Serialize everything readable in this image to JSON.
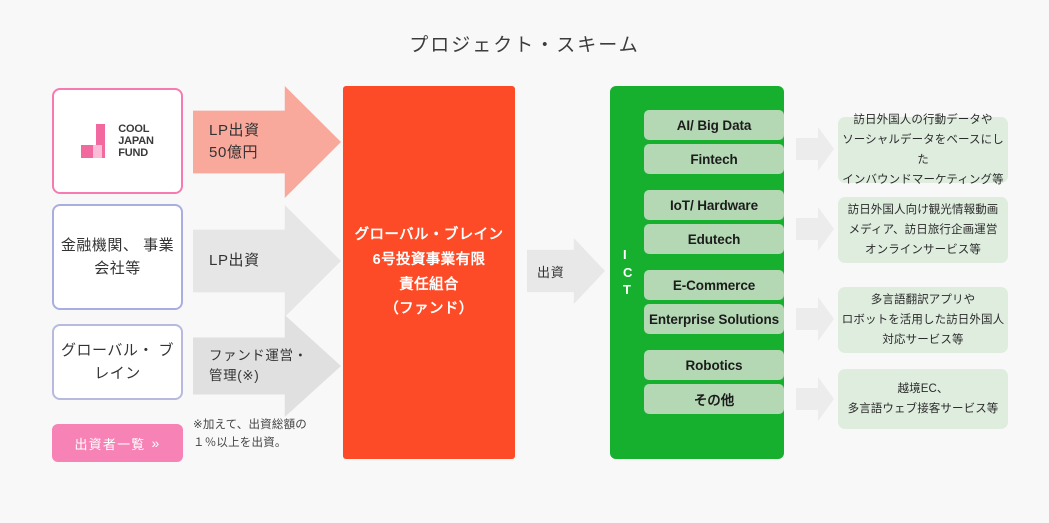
{
  "page": {
    "title": "プロジェクト・スキーム",
    "background_color": "#f8f8f8"
  },
  "sources": {
    "items": [
      {
        "id": "cool-japan-fund",
        "type": "logo",
        "logo_lines": [
          "COOL",
          "JAPAN",
          "FUND"
        ],
        "border_color": "#f77ab0"
      },
      {
        "id": "financial-institutions",
        "type": "text",
        "label": "金融機関、\n事業会社等",
        "border_color": "#a9aee0"
      },
      {
        "id": "global-brain",
        "type": "text",
        "label": "グローバル・\nブレイン",
        "border_color": "#b7b9de"
      }
    ],
    "investors_button": {
      "label": "出資者一覧",
      "chevron": "»",
      "color": "#f782b5"
    }
  },
  "flows": {
    "arrows": [
      {
        "id": "lp-investment-5b",
        "label": "LP出資\n50億円",
        "color": "#f9a99c"
      },
      {
        "id": "lp-investment",
        "label": "LP出資",
        "color": "#e6e6e6"
      },
      {
        "id": "fund-management",
        "label": "ファンド運営・\n管理(※)",
        "color": "#e0e0e0"
      }
    ],
    "footnote": "※加えて、出資総額の\n１％以上を出資。",
    "fund_to_ict": {
      "label": "出資",
      "color": "#e8e8e8"
    }
  },
  "fund": {
    "name": "グローバル・ブレイン\n6号投資事業有限\n責任組合\n（ファンド）",
    "color": "#fc4b26"
  },
  "ict": {
    "vertical_label": "I\nC\nT",
    "color": "#17af2e",
    "pill_color": "#b4d8b4",
    "groups": [
      {
        "pills": [
          "AI/ Big Data",
          "Fintech"
        ]
      },
      {
        "pills": [
          "IoT/ Hardware",
          "Edutech"
        ]
      },
      {
        "pills": [
          "E-Commerce",
          "Enterprise Solutions"
        ]
      },
      {
        "pills": [
          "Robotics",
          "その他"
        ]
      }
    ]
  },
  "outcomes": {
    "color": "#dfeddf",
    "items": [
      {
        "text": "訪日外国人の行動データや\nソーシャルデータをベースにした\nインバウンドマーケティング等"
      },
      {
        "text": "訪日外国人向け観光情報動画\nメディア、訪日旅行企画運営\nオンラインサービス等"
      },
      {
        "text": "多言語翻訳アプリや\nロボットを活用した訪日外国人\n対応サービス等"
      },
      {
        "text": "越境EC、\n多言語ウェブ接客サービス等"
      }
    ]
  }
}
